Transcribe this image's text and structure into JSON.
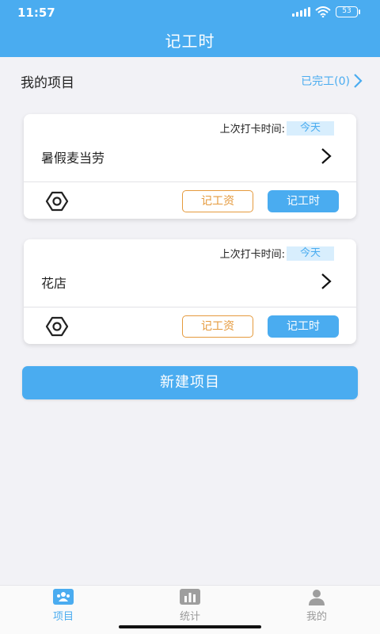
{
  "status_bar": {
    "time": "11:57",
    "battery": "53"
  },
  "header": {
    "title": "记工时"
  },
  "section": {
    "title": "我的项目",
    "finished_link": "已完工(0)"
  },
  "projects": [
    {
      "name": "暑假麦当劳",
      "last_label": "上次打卡时间:",
      "last_value": "今天",
      "wage_button": "记工资",
      "hours_button": "记工时"
    },
    {
      "name": "花店",
      "last_label": "上次打卡时间:",
      "last_value": "今天",
      "wage_button": "记工资",
      "hours_button": "记工时"
    }
  ],
  "new_project_button": "新建项目",
  "tabbar": {
    "items": [
      {
        "label": "项目",
        "icon": "people-icon",
        "active": true
      },
      {
        "label": "统计",
        "icon": "chart-icon",
        "active": false
      },
      {
        "label": "我的",
        "icon": "person-icon",
        "active": false
      }
    ]
  },
  "colors": {
    "accent": "#4aacf0",
    "wage_button": "#e59a3d",
    "background": "#f2f2f6"
  }
}
